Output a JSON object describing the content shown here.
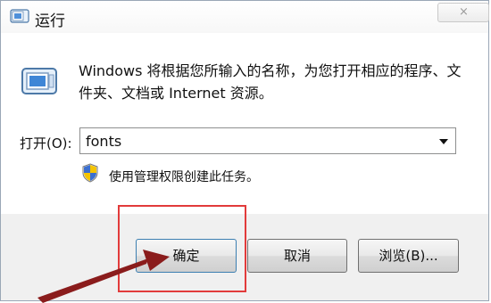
{
  "window": {
    "title": "运行",
    "close_symbol": "×"
  },
  "content": {
    "description": "Windows 将根据您所输入的名称，为您打开相应的程序、文件夹、文档或 Internet 资源。",
    "open_label": "打开(O):",
    "open_value": "fonts",
    "admin_note": "使用管理权限创建此任务。"
  },
  "buttons": {
    "ok": "确定",
    "cancel": "取消",
    "browse": "浏览(B)..."
  },
  "icons": {
    "title_icon": "run-icon",
    "main_icon": "run-icon",
    "shield_icon": "uac-shield-icon",
    "dropdown_icon": "chevron-down-icon"
  },
  "colors": {
    "highlight": "#e23b3b",
    "arrow": "#8a1c1c"
  }
}
